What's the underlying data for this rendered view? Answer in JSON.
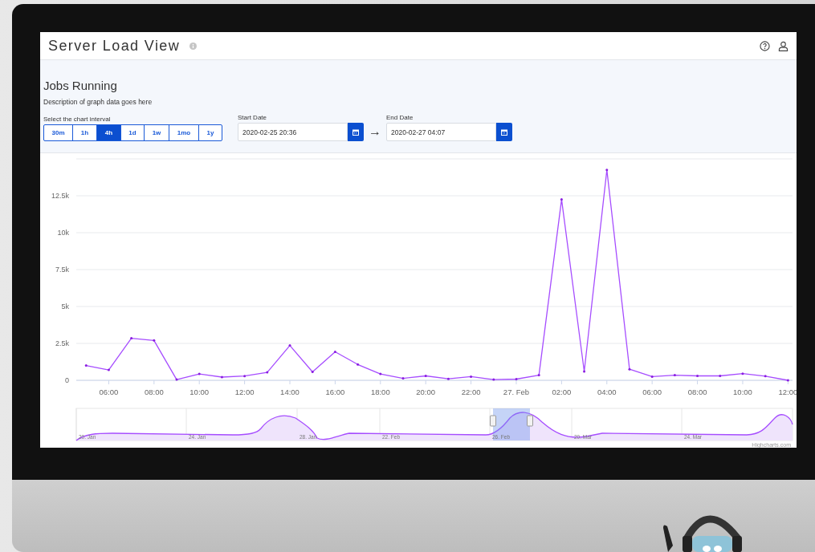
{
  "header": {
    "title": "Server Load View"
  },
  "panel": {
    "heading": "Jobs Running",
    "description": "Description of graph data goes here",
    "interval_label": "Select the chart interval",
    "intervals": [
      {
        "label": "30m",
        "selected": false
      },
      {
        "label": "1h",
        "selected": false
      },
      {
        "label": "4h",
        "selected": true
      },
      {
        "label": "1d",
        "selected": false
      },
      {
        "label": "1w",
        "selected": false
      },
      {
        "label": "1mo",
        "selected": false
      },
      {
        "label": "1y",
        "selected": false
      }
    ],
    "start_date": {
      "label": "Start Date",
      "value": "2020-02-25 20:36"
    },
    "end_date": {
      "label": "End Date",
      "value": "2020-02-27 04:07"
    },
    "arrow": "→"
  },
  "chart": {
    "chart_data": {
      "type": "line",
      "grid": true,
      "x": [
        "2020-02-26T05:00",
        "2020-02-26T06:00",
        "2020-02-26T07:00",
        "2020-02-26T08:00",
        "2020-02-26T09:00",
        "2020-02-26T10:00",
        "2020-02-26T11:00",
        "2020-02-26T12:00",
        "2020-02-26T13:00",
        "2020-02-26T14:00",
        "2020-02-26T15:00",
        "2020-02-26T16:00",
        "2020-02-26T17:00",
        "2020-02-26T18:00",
        "2020-02-26T19:00",
        "2020-02-26T20:00",
        "2020-02-26T21:00",
        "2020-02-26T22:00",
        "2020-02-26T23:00",
        "2020-02-27T00:00",
        "2020-02-27T01:00",
        "2020-02-27T02:00",
        "2020-02-27T03:00",
        "2020-02-27T04:00",
        "2020-02-27T05:00",
        "2020-02-27T06:00",
        "2020-02-27T07:00",
        "2020-02-27T08:00",
        "2020-02-27T09:00",
        "2020-02-27T10:00",
        "2020-02-27T11:00",
        "2020-02-27T12:00"
      ],
      "series": [
        {
          "color": "#a64dff",
          "values": [
            1000,
            700,
            2850,
            2700,
            50,
            430,
            220,
            290,
            540,
            2360,
            570,
            1930,
            1070,
            430,
            130,
            300,
            100,
            250,
            50,
            80,
            350,
            12250,
            600,
            14250,
            750,
            250,
            350,
            300,
            300,
            450,
            280,
            0
          ]
        }
      ],
      "xlim": [
        "2020-02-26T04:34",
        "2020-02-27T12:12"
      ],
      "ylim": [
        0,
        15000
      ],
      "xticks": [
        {
          "value": "2020-02-26T06:00",
          "label": "06:00"
        },
        {
          "value": "2020-02-26T08:00",
          "label": "08:00"
        },
        {
          "value": "2020-02-26T10:00",
          "label": "10:00"
        },
        {
          "value": "2020-02-26T12:00",
          "label": "12:00"
        },
        {
          "value": "2020-02-26T14:00",
          "label": "14:00"
        },
        {
          "value": "2020-02-26T16:00",
          "label": "16:00"
        },
        {
          "value": "2020-02-26T18:00",
          "label": "18:00"
        },
        {
          "value": "2020-02-26T20:00",
          "label": "20:00"
        },
        {
          "value": "2020-02-26T22:00",
          "label": "22:00"
        },
        {
          "value": "2020-02-27T00:00",
          "label": "27. Feb"
        },
        {
          "value": "2020-02-27T02:00",
          "label": "02:00"
        },
        {
          "value": "2020-02-27T04:00",
          "label": "04:00"
        },
        {
          "value": "2020-02-27T06:00",
          "label": "06:00"
        },
        {
          "value": "2020-02-27T08:00",
          "label": "08:00"
        },
        {
          "value": "2020-02-27T10:00",
          "label": "10:00"
        },
        {
          "value": "2020-02-27T12:00",
          "label": "12:00"
        }
      ],
      "yticks": [
        {
          "value": 0,
          "label": "0"
        },
        {
          "value": 2500,
          "label": "2.5k"
        },
        {
          "value": 5000,
          "label": "5k"
        },
        {
          "value": 7500,
          "label": "7.5k"
        },
        {
          "value": 10000,
          "label": "10k"
        },
        {
          "value": 12500,
          "label": "12.5k"
        }
      ]
    }
  },
  "navigator": {
    "labels": [
      "20. Jan",
      "24. Jan",
      "28. Jan",
      "22. Feb",
      "26. Feb",
      "20. Mar",
      "24. Mar"
    ],
    "credit": "Highcharts.com"
  }
}
